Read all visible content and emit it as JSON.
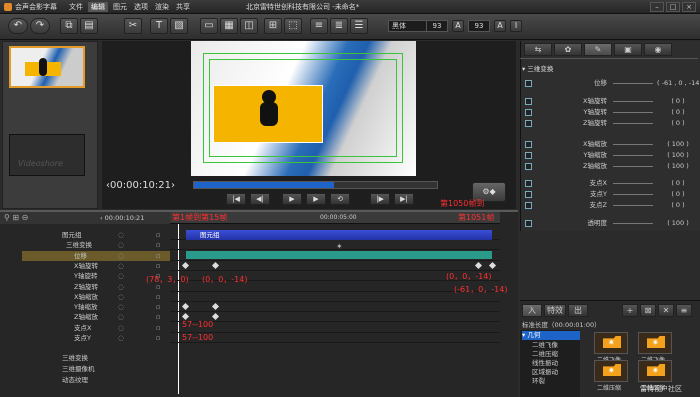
{
  "app": {
    "title": "会声会影字幕",
    "window_title": "北京雷特世创科技有限公司 -未命名*"
  },
  "menu": [
    "文件",
    "编辑",
    "图元",
    "选项",
    "渲染",
    "共享"
  ],
  "toolbar": {
    "font": "黑体",
    "size1": "93",
    "size2": "93"
  },
  "library": {
    "thumb2_caption": "Videoshore"
  },
  "preview": {
    "timecode": "00:00:10:21"
  },
  "props": {
    "group": "三维变换",
    "rows": [
      {
        "label": "位移",
        "value": "( -61 , 0 , -14 )",
        "key": true
      },
      {
        "label": "X轴旋转",
        "value": "( 0 )"
      },
      {
        "label": "Y轴旋转",
        "value": "( 0 )"
      },
      {
        "label": "Z轴旋转",
        "value": "( 0 )"
      },
      {
        "label": "X轴缩放",
        "value": "( 100 )",
        "key": true
      },
      {
        "label": "Y轴缩放",
        "value": "( 100 )",
        "key": true
      },
      {
        "label": "Z轴缩放",
        "value": "( 100 )"
      },
      {
        "label": "支点X",
        "value": "( 0 )"
      },
      {
        "label": "支点Y",
        "value": "( 0 )"
      },
      {
        "label": "支点Z",
        "value": "( 0 )"
      },
      {
        "label": "透明度",
        "value": "( 100 )"
      }
    ]
  },
  "timeline": {
    "timecode": "00:00:10:21",
    "ruler_mid": "00:00:05:00",
    "tracks": [
      "图元组",
      "三维变换",
      "位移",
      "X轴旋转",
      "Y轴旋转",
      "Z轴旋转",
      "X轴缩放",
      "Y轴缩放",
      "Z轴缩放",
      "支点X",
      "支点Y"
    ],
    "lower_tracks": [
      "三维变换",
      "三维摄像机",
      "动态纹理"
    ],
    "clip_label": "图元组",
    "annotations": {
      "frame_start": "第1帧到第15帧",
      "frame_end": "第1050帧到",
      "frame_end2": "第1051帧",
      "pos_start": "(78，3，0)",
      "pos_start2": "(0，0，-14)",
      "pos_end": "(0，0，-14)",
      "pos_end2": "(-61，0，-14)",
      "scale1": "57--100",
      "scale2": "57--100"
    }
  },
  "lowerright": {
    "tabs": [
      "入",
      "特效",
      "出"
    ],
    "duration": "标准长度（00:00:01:00）",
    "category": "几何",
    "items": [
      "二维飞像",
      "二维压缩",
      "线性振动",
      "区域振动",
      "环裂"
    ],
    "effects": [
      "二维飞像",
      "二维飞像",
      "二维压缩",
      "二维压缩"
    ]
  },
  "watermark": "雷特视户社区"
}
